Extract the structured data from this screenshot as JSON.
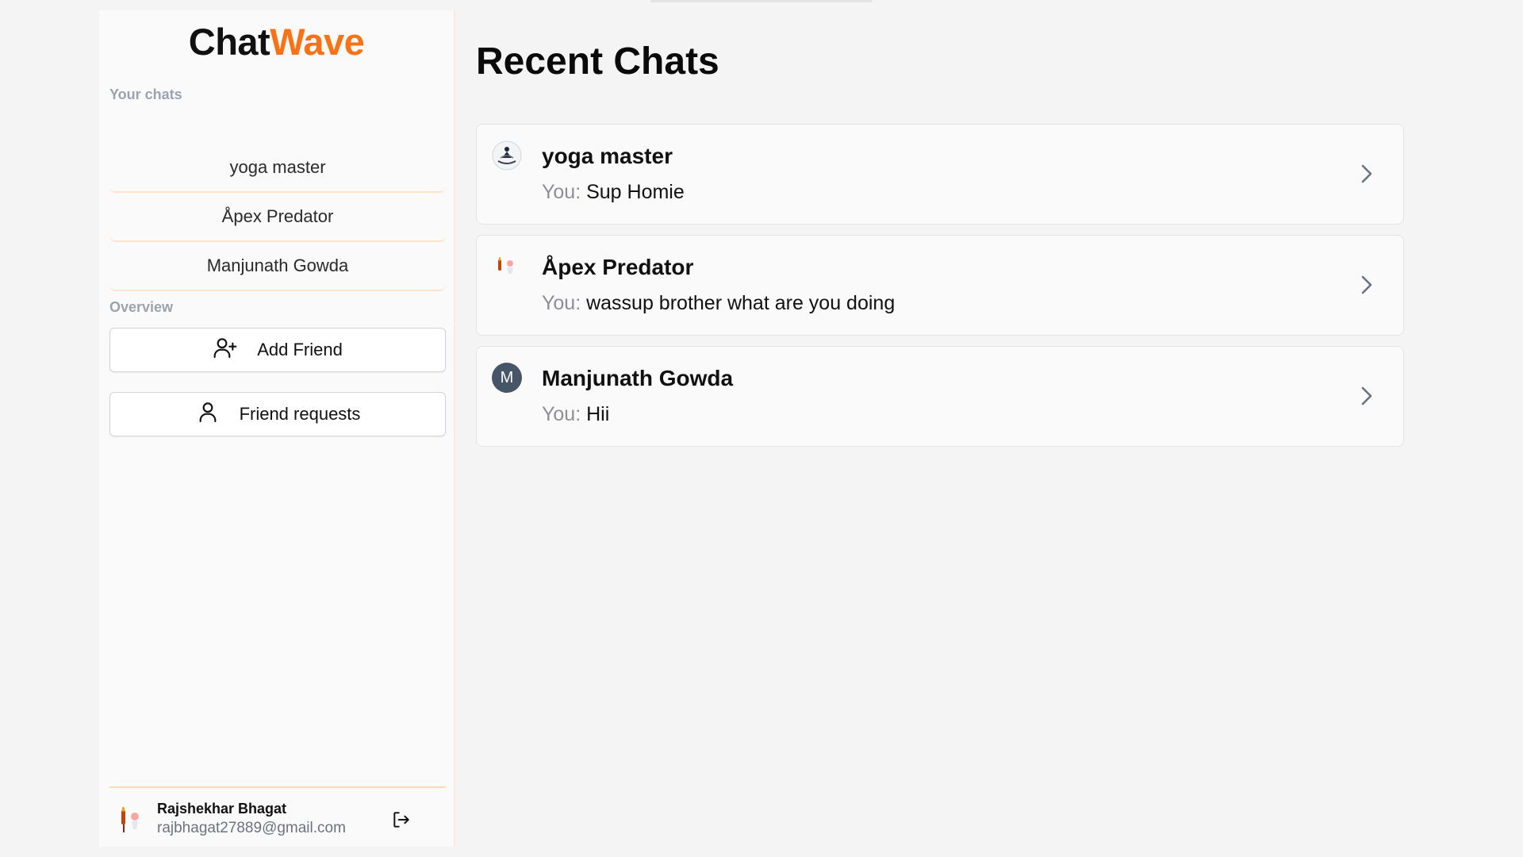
{
  "app": {
    "logo_part1": "Chat",
    "logo_part2": "Wave",
    "accent_color": "#f97316"
  },
  "sidebar": {
    "your_chats_label": "Your chats",
    "chats": [
      {
        "label": "yoga master"
      },
      {
        "label": "Åpex Predator"
      },
      {
        "label": "Manjunath Gowda"
      }
    ],
    "overview_label": "Overview",
    "add_friend_label": "Add Friend",
    "friend_requests_label": "Friend requests",
    "user": {
      "name": "Rajshekhar Bhagat",
      "email": "rajbhagat27889@gmail.com"
    }
  },
  "main": {
    "title": "Recent Chats",
    "chats": [
      {
        "name": "yoga master",
        "prefix": "You:",
        "message": "Sup Homie",
        "avatar": "yoga-logo"
      },
      {
        "name": "Åpex Predator",
        "prefix": "You:",
        "message": "wassup brother what are you doing",
        "avatar": "photo"
      },
      {
        "name": "Manjunath Gowda",
        "prefix": "You:",
        "message": "Hii",
        "avatar_letter": "M"
      }
    ]
  }
}
